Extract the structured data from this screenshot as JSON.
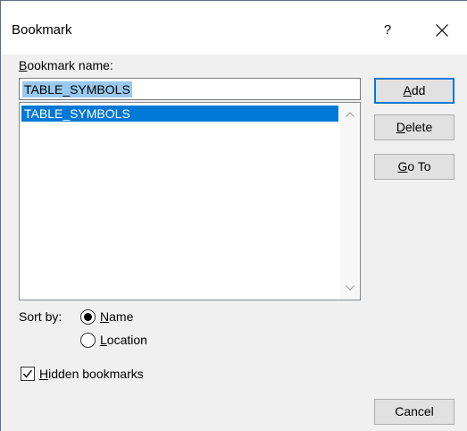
{
  "window": {
    "title": "Bookmark",
    "help_label": "?",
    "close_icon": "close-icon"
  },
  "bookmark_name": {
    "label_access_key": "B",
    "label_rest": "ookmark name:",
    "value": "TABLE_SYMBOLS"
  },
  "bookmarks_list": {
    "items": [
      "TABLE_SYMBOLS"
    ],
    "selected": "TABLE_SYMBOLS"
  },
  "buttons": {
    "add": {
      "access_key": "A",
      "rest": "dd"
    },
    "delete": {
      "access_key": "D",
      "rest": "elete"
    },
    "goto": {
      "access_key": "G",
      "rest": "o To"
    },
    "cancel": "Cancel"
  },
  "sort_by": {
    "label": "Sort by:",
    "name": {
      "access_key": "N",
      "rest": "ame",
      "checked": true
    },
    "location": {
      "access_key": "L",
      "rest": "ocation",
      "checked": false
    }
  },
  "hidden_bookmarks": {
    "access_key": "H",
    "rest": "idden bookmarks",
    "checked": true
  },
  "colors": {
    "selection": "#0078d7",
    "text_selection": "#99c9ef",
    "dialog_bg": "#f0f0f0"
  }
}
